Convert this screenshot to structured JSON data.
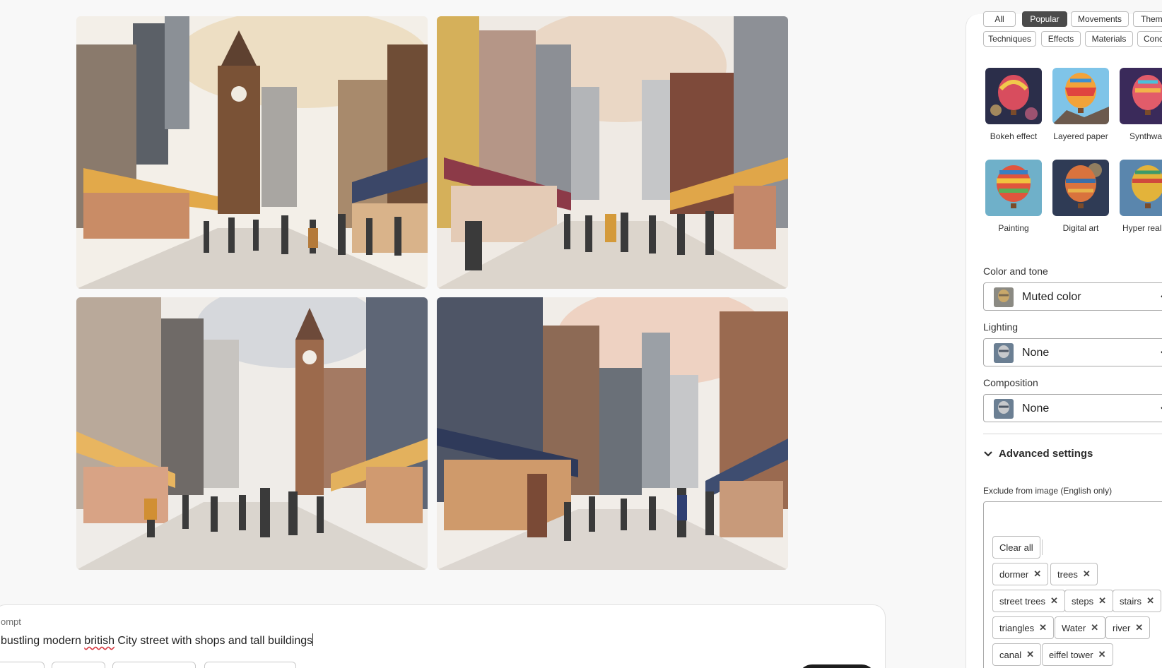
{
  "images": [
    {
      "alt": "watercolor-street-1"
    },
    {
      "alt": "watercolor-street-2"
    },
    {
      "alt": "watercolor-street-3"
    },
    {
      "alt": "watercolor-street-4"
    }
  ],
  "prompt": {
    "label": "ompt",
    "text_before": "bustling modern ",
    "text_typo": "british",
    "text_after": " City street with shops and tall buildings"
  },
  "style_filters": {
    "row1": [
      "All",
      "Popular",
      "Movements",
      "Theme"
    ],
    "row2": [
      "Techniques",
      "Effects",
      "Materials",
      "Concep"
    ],
    "active": "Popular"
  },
  "styles": [
    {
      "label": "Bokeh effect",
      "icon": "bokeh-balloon"
    },
    {
      "label": "Layered paper",
      "icon": "paper-balloon"
    },
    {
      "label": "Synthwav",
      "icon": "synthwave-balloon"
    },
    {
      "label": "Painting",
      "icon": "painting-balloon"
    },
    {
      "label": "Digital art",
      "icon": "digital-art-balloon"
    },
    {
      "label": "Hyper reali",
      "icon": "hyper-real-balloon"
    }
  ],
  "color_tone": {
    "label": "Color and tone",
    "value": "Muted color"
  },
  "lighting": {
    "label": "Lighting",
    "value": "None"
  },
  "composition": {
    "label": "Composition",
    "value": "None"
  },
  "advanced": {
    "title": "Advanced settings",
    "exclude_label": "Exclude from image (English only)",
    "clear_all": "Clear all",
    "tags": [
      "dormer",
      "trees",
      "street trees",
      "steps",
      "stairs",
      "triangles",
      "Water",
      "river",
      "canal",
      "eiffel tower"
    ]
  },
  "colors": {
    "active_filter": "#4b4b4b",
    "generate_button": "#1d1d1d",
    "spellcheck": "#d7373f"
  }
}
